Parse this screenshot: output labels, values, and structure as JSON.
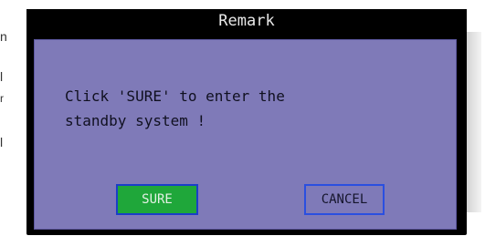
{
  "background_fragments": [
    "n",
    "l",
    "r",
    "l"
  ],
  "dialog": {
    "title": "Remark",
    "message": "Click 'SURE' to enter the\nstandby system !",
    "buttons": {
      "sure": "SURE",
      "cancel": "CANCEL"
    }
  },
  "colors": {
    "dialog_body": "#7f7ab8",
    "title_bar": "#000000",
    "sure_button": "#1fa73a",
    "button_border": "#2a4fe0"
  }
}
